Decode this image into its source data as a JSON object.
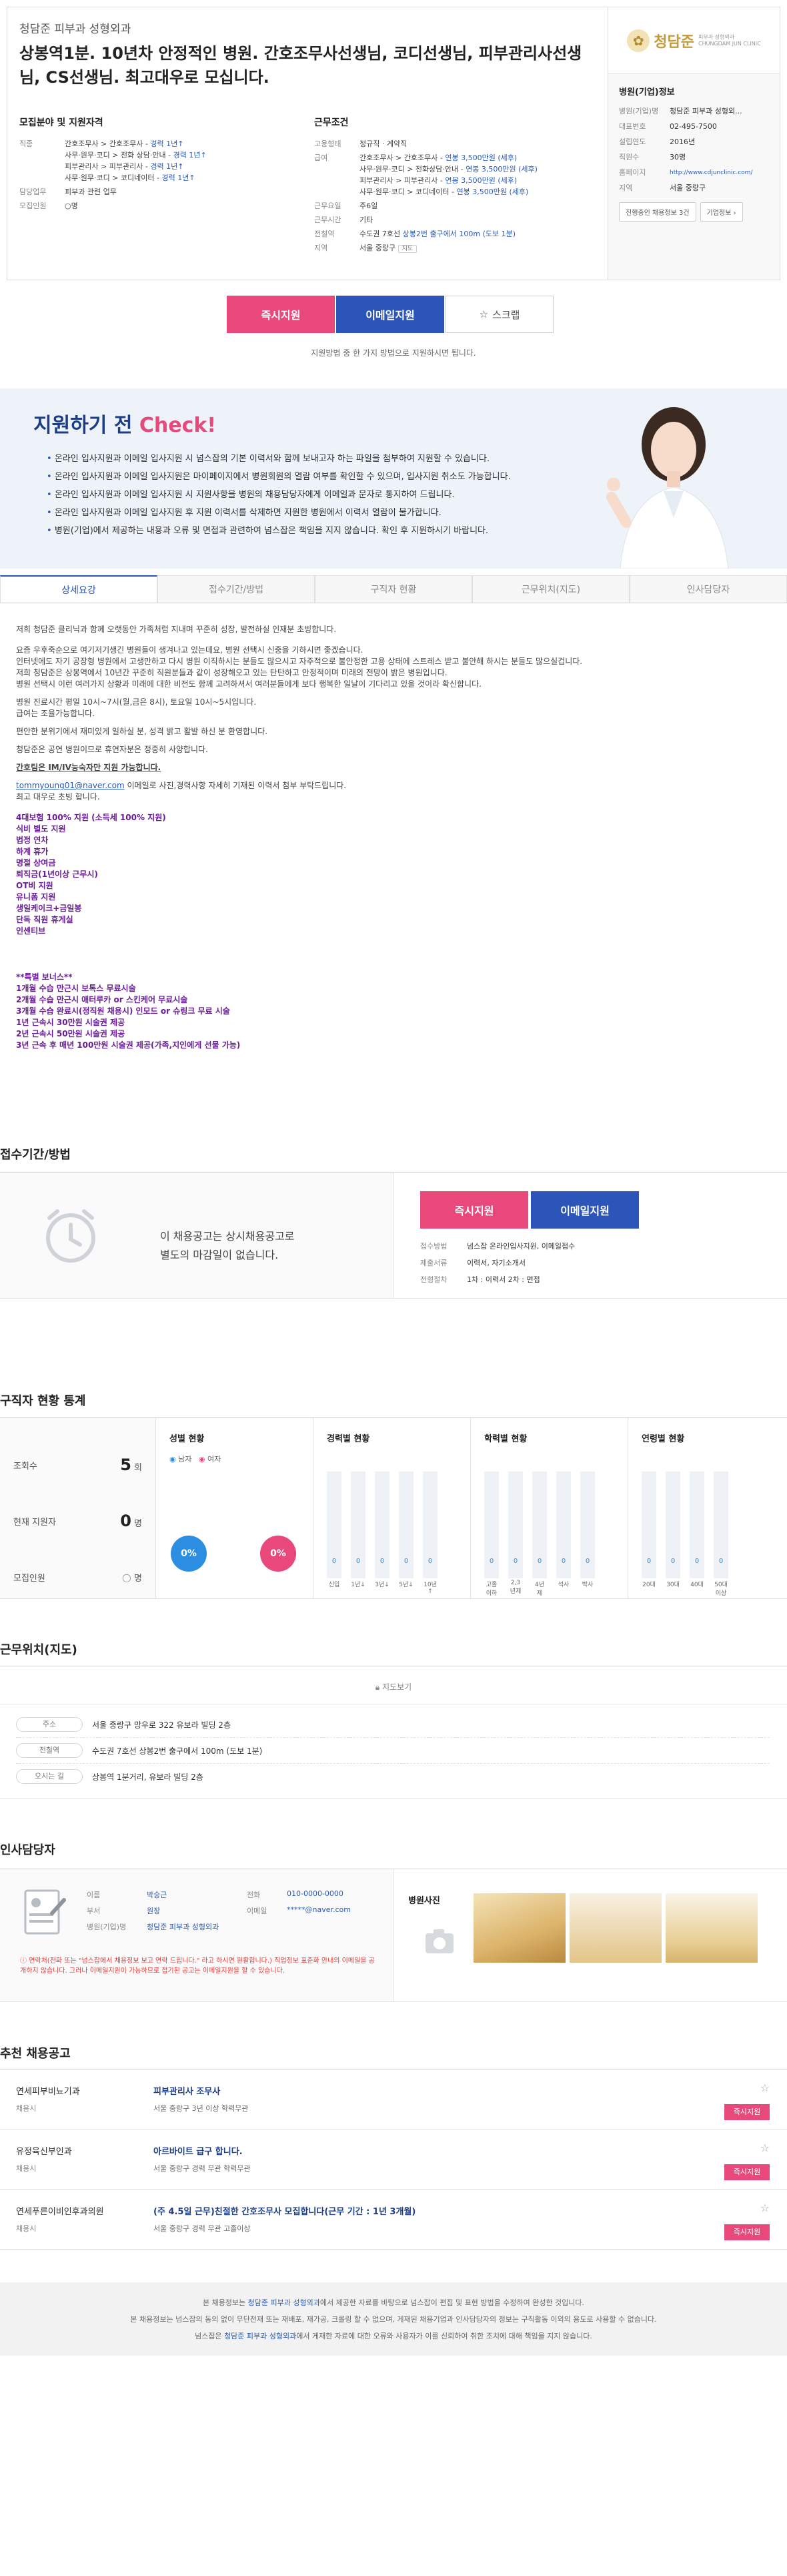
{
  "header": {
    "company": "청담준 피부과 성형외과",
    "title": "상봉역1분. 10년차 안정적인 병원. 간호조무사선생님, 코디선생님, 피부관리사선생님, CS선생님. 최고대우로 모십니다.",
    "req_title": "모집분야 및 지원자격",
    "req": [
      {
        "k": "직종",
        "lines": [
          [
            "간호조무사 > 간호조무사 - ",
            "경력 1년↑"
          ],
          [
            "사무·원무·코디 > 전화 상담·안내 - ",
            "경력 1년↑"
          ],
          [
            "피부관리사 > 피부관리사 - ",
            "경력 1년↑"
          ],
          [
            "사무·원무·코디 > 코디네이터 - ",
            "경력 1년↑"
          ]
        ]
      },
      {
        "k": "담당업무",
        "lines": [
          [
            "피부과 관련 업무",
            ""
          ]
        ]
      },
      {
        "k": "모집인원",
        "lines": [
          [
            "○명",
            ""
          ]
        ]
      }
    ],
    "cond_title": "근무조건",
    "cond": [
      {
        "k": "고용형태",
        "lines": [
          [
            "정규직 · 계약직",
            ""
          ]
        ]
      },
      {
        "k": "급여",
        "lines": [
          [
            "간호조무사 > 간호조무사 - ",
            "연봉 3,500만원 (세후)"
          ],
          [
            "사무·원무·코디 > 전화상담·안내 - ",
            "연봉 3,500만원 (세후)"
          ],
          [
            "피부관리사 > 피부관리사 - ",
            "연봉 3,500만원 (세후)"
          ],
          [
            "사무·원무·코디 > 코디네이터 - ",
            "연봉 3,500만원 (세후)"
          ]
        ]
      },
      {
        "k": "근무요일",
        "lines": [
          [
            "주6일",
            ""
          ]
        ]
      },
      {
        "k": "근무시간",
        "lines": [
          [
            "기타",
            ""
          ]
        ]
      },
      {
        "k": "전철역",
        "lines": [
          [
            "수도권 7호선 ",
            "상봉2번 출구에서 100m (도보 1분)"
          ]
        ]
      },
      {
        "k": "지역",
        "lines": [
          [
            "서울 중랑구 ",
            "지도"
          ]
        ]
      }
    ]
  },
  "hospital": {
    "logo_text": "청담준",
    "logo_sub": "피부과 성형외과",
    "logo_sub2": "CHUNGDAM JUN CLINIC",
    "title": "병원(기업)정보",
    "rows": [
      {
        "k": "병원(기업)명",
        "v": "청담준 피부과 성형외..."
      },
      {
        "k": "대표번호",
        "v": "02-495-7500"
      },
      {
        "k": "설립연도",
        "v": "2016년"
      },
      {
        "k": "직원수",
        "v": "30명"
      },
      {
        "k": "홈페이지",
        "v": "http://www.cdjunclinic.com/"
      },
      {
        "k": "지역",
        "v": "서울 중랑구"
      }
    ],
    "btn_jobs": "진행중인 채용정보 3건",
    "btn_info": "기업정보"
  },
  "apply": {
    "immediate": "즉시지원",
    "email": "이메일지원",
    "scrap": "스크랩",
    "note": "지원방법 중 한 가지 방법으로 지원하시면 됩니다."
  },
  "check": {
    "title": "지원하기 전",
    "accent": "Check!",
    "items": [
      "온라인 입사지원과 이메일 입사지원 시 넘스잡의 기본 이력서와 함께 보내고자 하는 파일을 첨부하여 지원할 수 있습니다.",
      "온라인 입사지원과 이메일 입사지원은 마이페이지에서 병원회원의 열람 여부를 확인할 수 있으며, 입사지원 취소도 가능합니다.",
      "온라인 입사지원과 이메일 입사지원 시 지원사항을 병원의 채용담당자에게 이메일과 문자로 통지하여 드립니다.",
      "온라인 입사지원과 이메일 입사지원 후 지원 이력서를 삭제하면 지원한 병원에서 이력서 열람이 불가합니다.",
      "병원(기업)에서 제공하는 내용과 오류 및 면접과 관련하여 넘스잡은 책임을 지지 않습니다. 확인 후 지원하시기 바랍니다."
    ]
  },
  "tabs": [
    "상세요강",
    "접수기간/방법",
    "구직자 현황",
    "근무위치(지도)",
    "인사담당자"
  ],
  "detail": {
    "p1": "저희 청담준 클리닉과 함께 오랫동안 가족처럼 지내며 꾸준히 성장, 발전하실 인재분 초빙합니다.",
    "p2": "요즘 우후죽순으로 여기저기생긴 병원들이 생겨나고 있는데요, 병원 선택시 신중을 기하시면 좋겠습니다.",
    "p3": "인터넷에도 자기 공장형 병원에서 고생만하고 다시 병원 이직하시는 분들도 많으시고 자주적으로 불안정한 고용 상태에 스트레스 받고 불안해 하시는 분들도 많으실겁니다.",
    "p4": "저희 청담준은 상봉역에서 10년간 꾸준히 직원분들과 같이 성장해오고 있는 탄탄하고 안정적이며 미래의 전망이 밝은 병원입니다.",
    "p5": "병원 선택시 이런 여러가지 상황과 미래에 대한 비전도 함께 고려하셔서 여러분들에게 보다 행복한 일날이 기다리고 있을 것이라 확신합니다.",
    "p6": "병원 진료시간 평일 10시~7시(월,금은 8시), 토요일 10시~5시입니다.",
    "p7": "급여는 조율가능합니다.",
    "p8": "편안한 분위기에서 재미있게 일하실 분, 성격 밝고 활발 하신 분 환영합니다.",
    "p9": "청담준은 공연 병원이므로 휴연자분은 정중히 사양합니다.",
    "p10": "간호팀은 IM/IV능숙자만 지원 가능합니다.",
    "email": "tommyoung01@naver.com",
    "p11": " 이메일로 사진,경력사항 자세히 기재된 이력서 첨부 부탁드립니다.",
    "p12": "최고 대우로 초빙 합니다.",
    "benefits": [
      "4대보험 100% 지원 (소득세 100% 지원)",
      "식비 별도 지원",
      "법정 연차",
      "하계 휴가",
      "명절 상여금",
      "퇴직금(1년이상 근무시)",
      "OT비 지원",
      "유니폼 지원",
      "생일케이크+금일봉",
      "단독 직원 휴게실",
      "인센티브"
    ],
    "bonus_title": "**특별 보너스**",
    "bonus": [
      "1개월 수습 만근시 보톡스 무료시술",
      "2개월 수습 만근시 애터루카 or 스킨케어 무료시술",
      "3개월 수습 완료시(정직원 채용시) 인모드 or 슈링크 무료 시술",
      "1년 근속시 30만원 시술권 제공",
      "2년 근속시 50만원 시술권 제공",
      "3년 근속 후 매년 100만원 시술권 제공(가족,지인에게 선물 가능)"
    ]
  },
  "reception": {
    "title": "접수기간/방법",
    "msg1": "이 채용공고는 상시채용공고로",
    "msg2": "별도의 마감일이 없습니다.",
    "rows": [
      {
        "k": "접수방법",
        "v": "넘스잡 온라인입사지원, 이메일접수"
      },
      {
        "k": "제출서류",
        "v": "이력서, 자기소개서"
      },
      {
        "k": "전형절차",
        "v": "1차 : 이력서   2차 : 면접"
      }
    ]
  },
  "stats": {
    "title": "구직자 현황 통계",
    "views_label": "조회수",
    "views": "5",
    "views_unit": "회",
    "applicants_label": "현재 지원자",
    "applicants": "0",
    "applicants_unit": "명",
    "recruit_label": "모집인원",
    "recruit": "○",
    "recruit_unit": "명",
    "gender_title": "성별 현황",
    "male": "남자",
    "female": "여자",
    "male_pct": "0%",
    "female_pct": "0%",
    "career_title": "경력별 현황",
    "career_labels": [
      "신입",
      "1년↓",
      "3년↓",
      "5년↓",
      "10년↑"
    ],
    "career_values": [
      0,
      0,
      0,
      0,
      0
    ],
    "edu_title": "학력별 현황",
    "edu_labels": [
      "고졸이하",
      "2,3년제",
      "4년제",
      "석사",
      "박사"
    ],
    "edu_values": [
      0,
      0,
      0,
      0,
      0
    ],
    "age_title": "연령별 현황",
    "age_labels": [
      "20대",
      "30대",
      "40대",
      "50대이상"
    ],
    "age_values": [
      0,
      0,
      0,
      0
    ]
  },
  "location": {
    "title": "근무위치(지도)",
    "map_btn": "지도보기",
    "rows": [
      {
        "k": "주소",
        "v": "서울 중랑구 망우로 322 유보라 빌딩 2층"
      },
      {
        "k": "전철역",
        "v": "수도권 7호선 상봉2번 출구에서 100m (도보 1분)"
      },
      {
        "k": "오시는 길",
        "v": "상봉역 1분거리, 유보라 빌딩 2층"
      }
    ]
  },
  "manager": {
    "title": "인사담당자",
    "k_name": "이름",
    "name": "박승근",
    "k_phone": "전화",
    "phone": "010-0000-0000",
    "k_dept": "부서",
    "dept": "원장",
    "k_email": "이메일",
    "email": "*****@naver.com",
    "k_hosp": "병원(기업)명",
    "hosp": "청담준 피부과 성형외과",
    "warn": "연락처(전화 또는 \"넘스잡에서 채용정보 보고 연락 드립니다.\" 라고 하시면 원활합니다.)   직업정보 표준화 안내의 이메일을 공개하지 않습니다. 그러나 이메일지원이 가능하므로 접기된 공고는 이메일지원을 할 수 있습니다.",
    "photo_title": "병원사진"
  },
  "recommend": {
    "title": "추천 채용공고",
    "items": [
      {
        "co": "연세피부비뇨기과",
        "st": "채용시",
        "tt": "피부관리사 조무사",
        "meta": "서울 중랑구    3년 이상    학력무관",
        "apply": "즉시지원"
      },
      {
        "co": "유정육신부인과",
        "st": "채용시",
        "tt": "아르바이트 급구 합니다.",
        "meta": "서울 중랑구    경력 무관    학력무관",
        "apply": "즉시지원"
      },
      {
        "co": "연세푸른이비인후과의원",
        "st": "채용시",
        "tt": "(주 4.5일 근무)친절한 간호조무사 모집합니다(근무 기간 : 1년 3개월)",
        "meta": "서울 중랑구    경력 무관    고졸이상",
        "apply": "즉시지원"
      }
    ]
  },
  "footer": {
    "l1a": "본 채용정보는 ",
    "l1b": "청담준 피부과 성형외과",
    "l1c": "에서 제공한 자료를 바탕으로 넘스잡이 편집 및 표현 방법을 수정하여 완성한 것입니다.",
    "l2": "본 채용정보는 넘스잡의 동의 없이 무단전재 또는 재배포, 재가공, 크롤링 할 수 없으며, 게재된 채용기업과 인사담당자의 정보는 구직활동 이외의 용도로 사용할 수 없습니다.",
    "l3a": "넘스잡은 ",
    "l3b": "청담준 피부과 성형외과",
    "l3c": "에서 게재한 자료에 대한 오류와 사용자가 이를 신뢰하여 취한 조치에 대해 책임을 지지 않습니다."
  }
}
